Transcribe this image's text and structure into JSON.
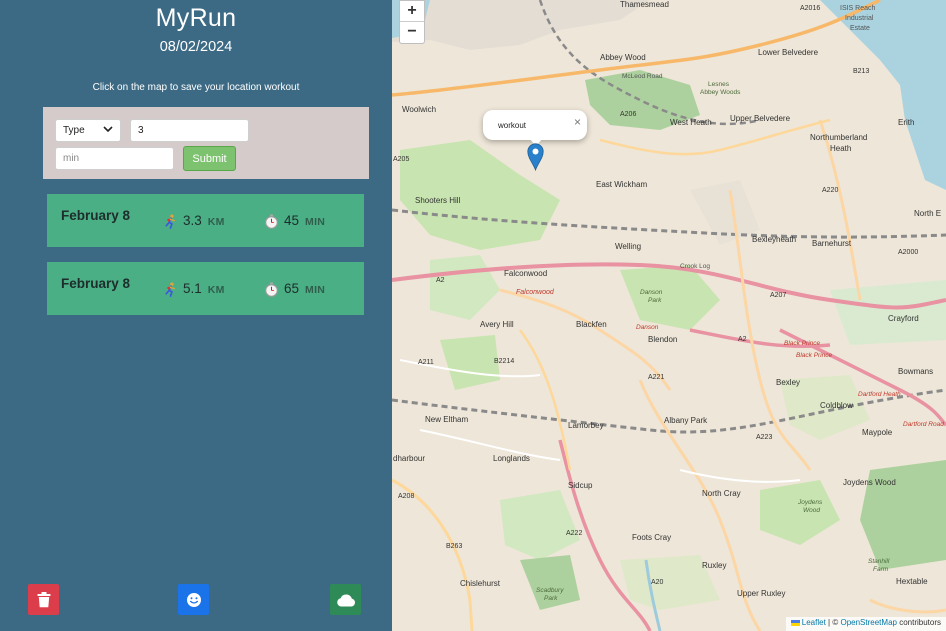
{
  "app": {
    "title": "MyRun",
    "date": "08/02/2024",
    "hint": "Click on the map to save your location workout"
  },
  "form": {
    "type_label": "Type",
    "distance_value": "3",
    "duration_placeholder": "min",
    "submit_label": "Submit"
  },
  "workouts": [
    {
      "date": "February 8",
      "distance": "3.3",
      "distance_unit": "KM",
      "duration": "45",
      "duration_unit": "MIN",
      "activity_icon": "running-icon",
      "time_icon": "stopwatch-icon"
    },
    {
      "date": "February 8",
      "distance": "5.1",
      "distance_unit": "KM",
      "duration": "65",
      "duration_unit": "MIN",
      "activity_icon": "running-icon",
      "time_icon": "stopwatch-icon"
    }
  ],
  "footer_buttons": [
    {
      "icon": "trash-icon",
      "color": "#dc3d4b"
    },
    {
      "icon": "smile-icon",
      "color": "#1a73e8"
    },
    {
      "icon": "cloud-icon",
      "color": "#2e8a57"
    }
  ],
  "map": {
    "zoom_in": "+",
    "zoom_out": "−",
    "popup_text": "workout",
    "popup_close": "×",
    "attribution_leaflet": "Leaflet",
    "attribution_sep": "| ©",
    "attribution_osm": "OpenStreetMap",
    "attribution_suffix": "contributors",
    "labels": {
      "thamesmead": "Thamesmead",
      "a2016": "A2016",
      "isis": "ISIS Reach",
      "industrial": "Industrial",
      "estate": "Estate",
      "abbey_wood": "Abbey Wood",
      "lower_belvedere": "Lower Belvedere",
      "mcleod": "McLeod Road",
      "lesnes": "Lesnes",
      "abbey_woods": "Abbey Woods",
      "b213": "B213",
      "woolwich": "Woolwich",
      "a206": "A206",
      "west_heath": "West Heath",
      "upper_belvedere": "Upper Belvedere",
      "erith": "Erith",
      "northumberland": "Northumberland",
      "heath": "Heath",
      "a205": "A205",
      "east_wickham": "East Wickham",
      "a220": "A220",
      "shooters_hill": "Shooters Hill",
      "north_end": "North E",
      "welling": "Welling",
      "bexleyheath": "Bexleyheath",
      "barnehurst": "Barnehurst",
      "a2000": "A2000",
      "a2": "A2",
      "falconwood": "Falconwood",
      "falconwood_stn": "Falconwood",
      "crook_log": "Crook Log",
      "a207": "A207",
      "danson": "Danson",
      "park": "Park",
      "crayford": "Crayford",
      "avery_hill": "Avery Hill",
      "blackfen": "Blackfen",
      "danson_rd": "Danson",
      "blendon": "Blendon",
      "a2b": "A2",
      "black_prince": "Black Prince",
      "black_prince2": "Black Prince",
      "a211": "A211",
      "b2214": "B2214",
      "a221": "A221",
      "bexley": "Bexley",
      "bowmans": "Bowmans",
      "dartford_heath": "Dartford Heath",
      "coldblow": "Coldblow",
      "new_eltham": "New Eltham",
      "lamorbey": "Lamorbey",
      "albany_park": "Albany Park",
      "a223": "A223",
      "maypole": "Maypole",
      "dartford_rd": "Dartford Road",
      "dharbour": "dharbour",
      "longlands": "Longlands",
      "sidcup": "Sidcup",
      "north_cray": "North Cray",
      "joydens_wood": "Joydens Wood",
      "a208": "A208",
      "joydens": "Joydens",
      "wood": "Wood",
      "a222": "A222",
      "foots_cray": "Foots Cray",
      "b263": "B263",
      "chislehurst": "Chislehurst",
      "a20": "A20",
      "ruxley": "Ruxley",
      "stanhill": "Stanhill",
      "farm": "Farm",
      "hextable": "Hextable",
      "upper_ruxley": "Upper Ruxley",
      "scadbury": "Scadbury",
      "park2": "Park"
    }
  }
}
